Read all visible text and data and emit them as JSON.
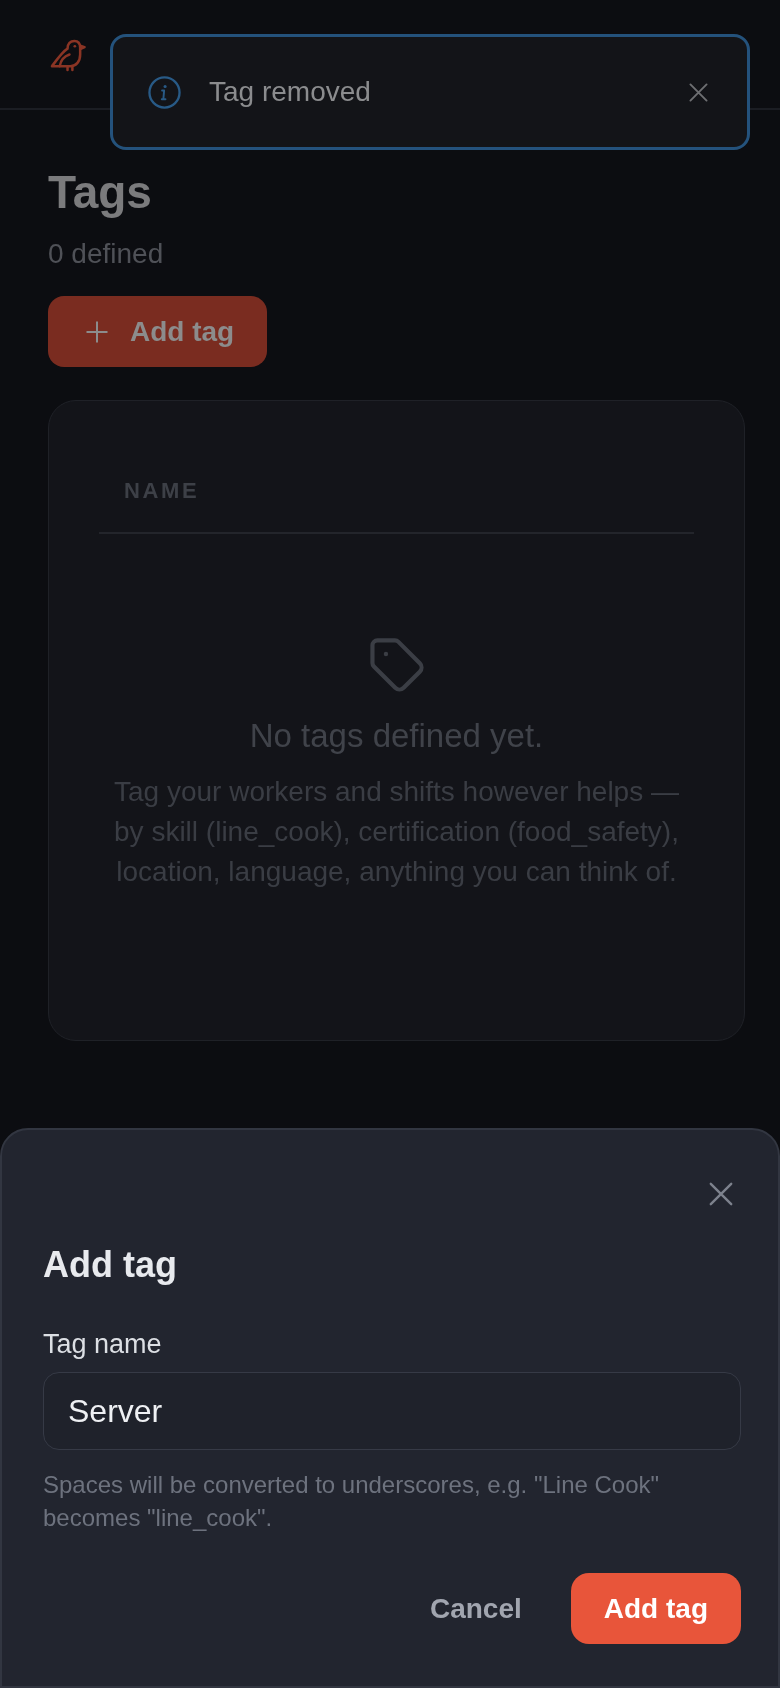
{
  "toast": {
    "kind": "info",
    "message": "Tag removed"
  },
  "page": {
    "title": "Tags",
    "subtitle": "0 defined",
    "add_button": "Add tag"
  },
  "table": {
    "columns": [
      "NAME"
    ],
    "empty_state": {
      "title": "No tags defined yet.",
      "text": "Tag your workers and shifts however helps — by skill (line_cook), certification (food_safety), location, language, anything you can think of."
    }
  },
  "dialog": {
    "title": "Add tag",
    "field": {
      "label": "Tag name",
      "value": "Server",
      "help_text": "Spaces will be converted to underscores, e.g. \"Line Cook\" becomes \"line_cook\"."
    },
    "buttons": [
      {
        "label": "Cancel",
        "kind": "secondary"
      },
      {
        "label": "Add tag",
        "kind": "primary"
      }
    ]
  }
}
